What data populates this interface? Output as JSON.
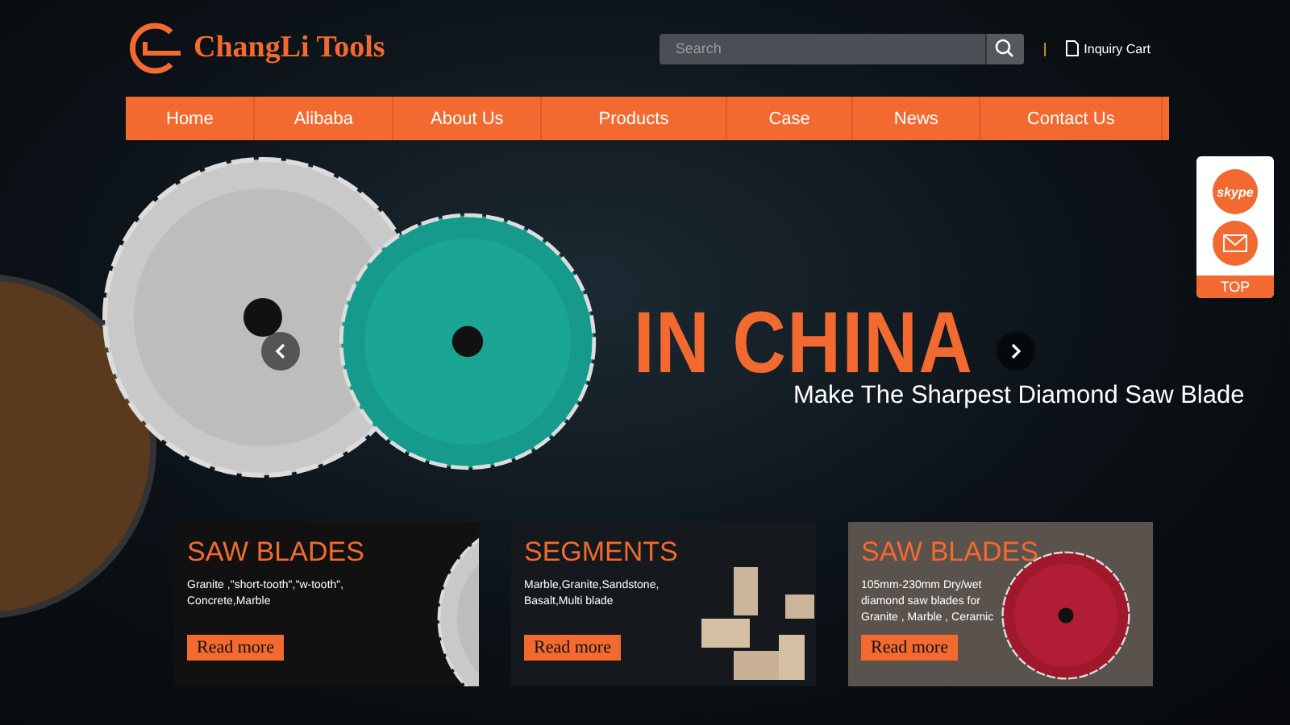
{
  "header": {
    "brand": "ChangLi Tools",
    "search": {
      "placeholder": "Search"
    },
    "separator": "|",
    "cart": "Inquiry Cart"
  },
  "nav": [
    {
      "label": "Home",
      "selected": false
    },
    {
      "label": "Alibaba",
      "selected": false
    },
    {
      "label": "About Us",
      "selected": false
    },
    {
      "label": "Products",
      "selected": false
    },
    {
      "label": "Case",
      "selected": false
    },
    {
      "label": "News",
      "selected": false
    },
    {
      "label": "Contact Us",
      "selected": false
    }
  ],
  "hero": {
    "headline": "IN CHINA",
    "subtitle": "Make The Sharpest Diamond Saw Blade"
  },
  "side_panel": {
    "skype": "skype",
    "top": "TOP"
  },
  "cards": [
    {
      "kind": "blade",
      "title": "SAW BLADES",
      "text": "Granite ,\"short-tooth\",\"w-tooth\", Concrete,Marble",
      "button": "Read more"
    },
    {
      "kind": "segments",
      "title": "SEGMENTS",
      "text": "Marble,Granite,Sandstone, Basalt,Multi blade",
      "button": "Read more"
    },
    {
      "kind": "red-blade",
      "title": "SAW BLADES",
      "text": "105mm-230mm Dry/wet diamond saw blades for Granite , Marble , Ceramic",
      "button": "Read more"
    }
  ]
}
